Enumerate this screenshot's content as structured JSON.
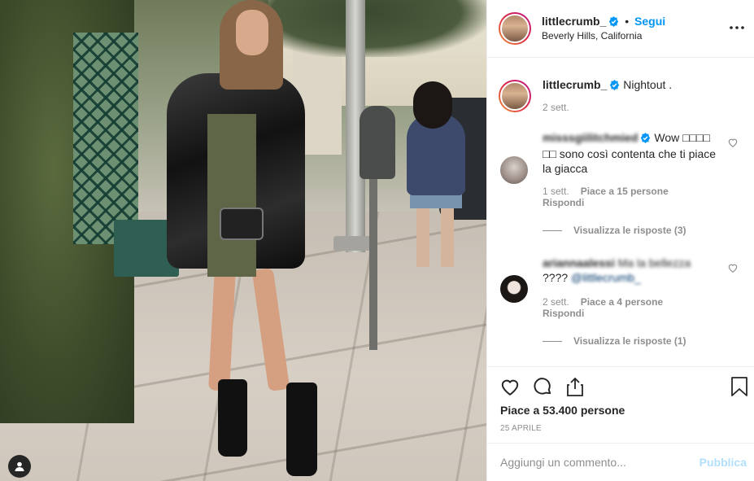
{
  "post": {
    "username": "littlecrumb_",
    "follow_label": "Segui",
    "separator": "•",
    "location": "Beverly Hills, California",
    "caption": "Nightout .",
    "caption_time": "2 sett.",
    "likes": "Piace a 53.400 persone",
    "date": "25 APRILE",
    "comment_placeholder": "Aggiungi un commento...",
    "post_label": "Pubblica"
  },
  "comments": [
    {
      "username": "misssgiilitchmied",
      "text": "Wow □□□□ □□ sono così contenta che ti piace la giacca",
      "time": "1 sett.",
      "likes": "Piace a 15 persone",
      "reply_label": "Rispondi",
      "view_replies": "Visualizza le risposte (3)"
    },
    {
      "username": "ariannaalessi",
      "text_blurred": "Ma la bellezza",
      "text": "????",
      "mention": "@littlecrumb_",
      "time": "2 sett.",
      "likes": "Piace a 4 persone",
      "reply_label": "Rispondi",
      "view_replies": "Visualizza le risposte (1)"
    }
  ],
  "icons": {
    "more": "more-options-icon",
    "verified": "verified-badge-icon",
    "like": "heart-icon",
    "comment": "comment-icon",
    "share": "share-icon",
    "save": "bookmark-icon",
    "user_tag": "user-tag-icon"
  },
  "colors": {
    "accent": "#0095f6",
    "muted": "#8e8e8e",
    "text": "#262626",
    "post_disabled": "#b2dffc"
  }
}
